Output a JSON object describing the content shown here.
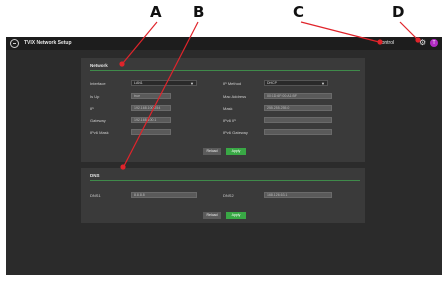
{
  "callouts": [
    "A",
    "B",
    "C",
    "D"
  ],
  "app": {
    "title": "TVIX Network Setup",
    "control_label": "Control",
    "user_initial": "T"
  },
  "network": {
    "title": "Network",
    "interface_label": "Interface",
    "interface_value": "LAN1",
    "ip_method_label": "IP Method",
    "ip_method_value": "DHCP",
    "is_up_label": "Is Up",
    "is_up_value": "true",
    "mac_label": "Mac Address",
    "mac_value": "00:1D:6F:00:A1:BF",
    "ip_label": "IP",
    "ip_value": "192.168.100.254",
    "mask_label": "Mask",
    "mask_value": "255.255.255.0",
    "gateway_label": "Gateway",
    "gateway_value": "192.168.100.1",
    "ipv6_ip_label": "IPv6 IP",
    "ipv6_mask_label": "IPv6 Mask",
    "ipv6_gateway_label": "IPv6 Gateway",
    "reload_label": "Reload",
    "apply_label": "Apply"
  },
  "dns": {
    "title": "DNS",
    "dns1_label": "DNS1",
    "dns1_value": "8.8.8.8",
    "dns2_label": "DNS2",
    "dns2_value": "168.126.63.1",
    "reload_label": "Reload",
    "apply_label": "Apply"
  },
  "colors": {
    "accent_green": "#39a845",
    "callout_red": "#e0242b",
    "user_badge": "#b32cc4"
  }
}
